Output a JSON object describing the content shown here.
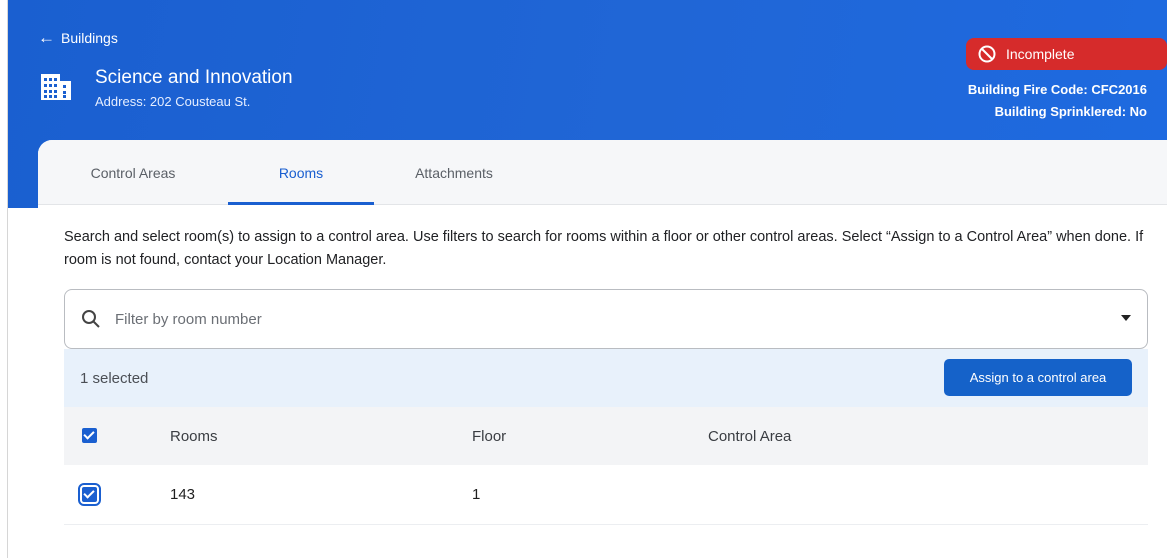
{
  "header": {
    "back_label": "Buildings",
    "building_name": "Science and Innovation",
    "building_address": "Address: 202 Cousteau St.",
    "status": "Incomplete",
    "fire_code": "Building Fire Code: CFC2016",
    "sprinklered": "Building Sprinklered: No",
    "colors": {
      "header_blue": "#1a5fd0",
      "status_red": "#d62b2b"
    }
  },
  "tabs": [
    {
      "label": "Control Areas",
      "active": false
    },
    {
      "label": "Rooms",
      "active": true
    },
    {
      "label": "Attachments",
      "active": false
    }
  ],
  "main": {
    "instructions": "Search and select room(s) to assign to a control area. Use filters to search for rooms within a floor or other control areas. Select “Assign to a Control Area” when done. If room is not found, contact your Location Manager.",
    "search": {
      "placeholder": "Filter by room number",
      "icon": "search-icon"
    },
    "selection": {
      "count_label": "1 selected",
      "assign_label": "Assign to a control area"
    },
    "table": {
      "columns": [
        "Rooms",
        "Floor",
        "Control Area"
      ],
      "rows": [
        {
          "room": "143",
          "floor": "1",
          "control_area": "",
          "checked": true
        }
      ]
    }
  }
}
